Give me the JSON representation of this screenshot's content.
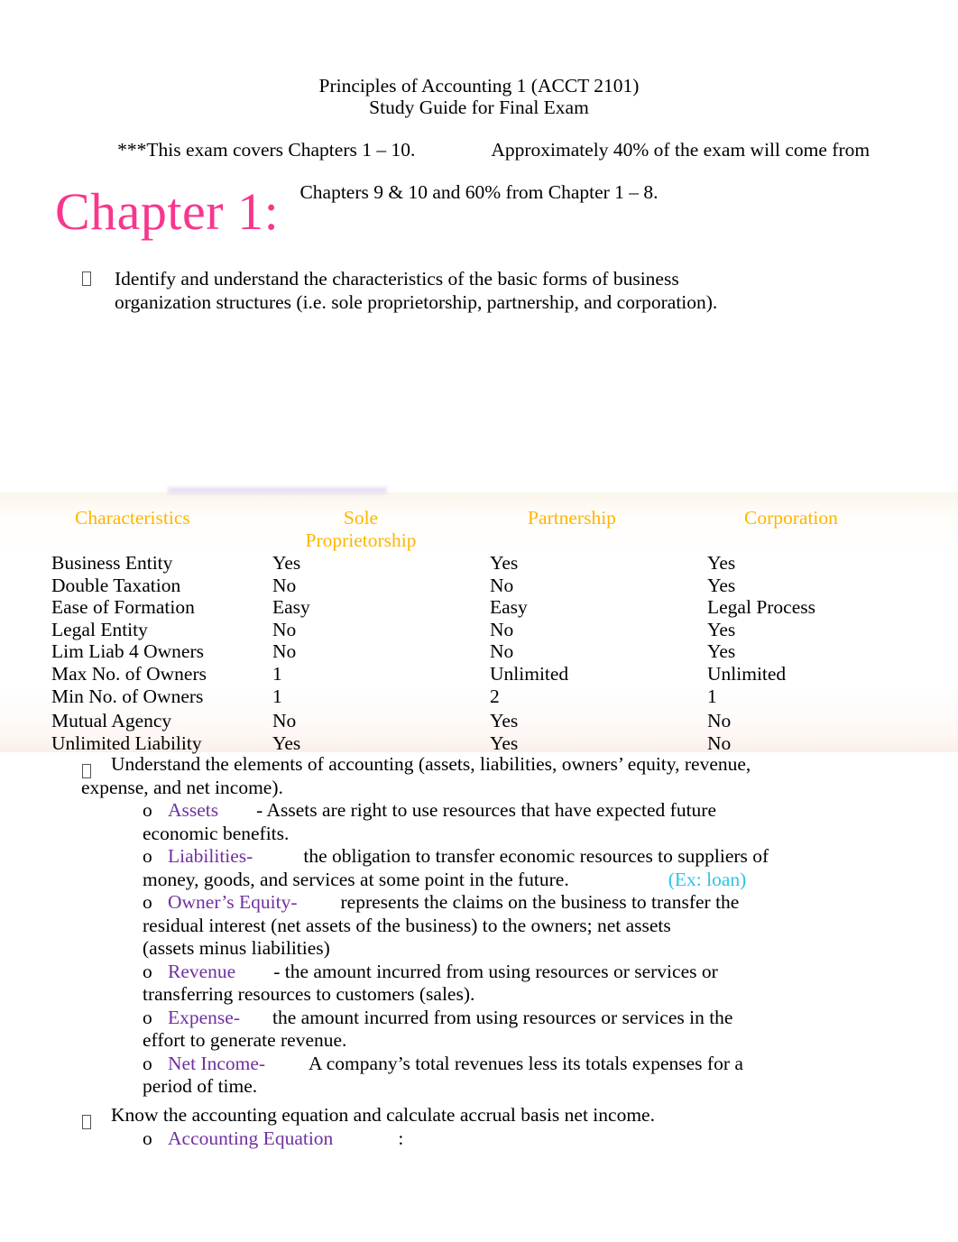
{
  "document": {
    "title_line_1": "Principles of Accounting 1 (ACCT 2101)",
    "title_line_2": "Study Guide for Final Exam",
    "note_line_1": "***This exam covers Chapters 1 – 10.",
    "note_line_1b": "Approximately 40% of the exam will come from",
    "note_line_2": "Chapters 9 & 10 and 60% from Chapter 1 – 8.",
    "chapter_heading": "Chapter 1:",
    "chapter_heading_color": "#F8368E"
  },
  "bullets": {
    "first": {
      "line_1": "Identify and understand the characteristics of the basic forms of business",
      "line_2": "organization structures (i.e. sole proprietorship, partnership, and corporation)."
    },
    "elements_intro": {
      "line_1": "Understand the elements of accounting (assets, liabilities, owners’ equity, revenue,",
      "line_2": "expense, and net income)."
    },
    "equation_intro": "Know the accounting equation and calculate accrual basis net income."
  },
  "table": {
    "header_color": "#FFB500",
    "columns": [
      "Characteristics",
      "Sole",
      "Proprietorship",
      "Partnership",
      "Corporation"
    ],
    "headers": {
      "characteristics": "Characteristics",
      "sole": "Sole",
      "proprietorship": "Proprietorship",
      "partnership": "Partnership",
      "corporation": "Corporation"
    },
    "rows": [
      {
        "label": "Business Entity",
        "sole": "Yes",
        "partnership": "Yes",
        "corporation": "Yes"
      },
      {
        "label": "Double Taxation",
        "sole": "No",
        "partnership": "No",
        "corporation": "Yes"
      },
      {
        "label": "Ease of Formation",
        "sole": "Easy",
        "partnership": "Easy",
        "corporation": "Legal Process"
      },
      {
        "label": "Legal Entity",
        "sole": "No",
        "partnership": "No",
        "corporation": "Yes"
      },
      {
        "label": "Lim Liab 4 Owners",
        "sole": "No",
        "partnership": "No",
        "corporation": "Yes"
      },
      {
        "label": "Max No. of Owners",
        "sole": "1",
        "partnership": "Unlimited",
        "corporation": "Unlimited"
      },
      {
        "label": "Min No. of Owners",
        "sole": "1",
        "partnership": "2",
        "corporation": "1"
      },
      {
        "label": "Mutual Agency",
        "sole": "No",
        "partnership": "Yes",
        "corporation": "No"
      },
      {
        "label": "Unlimited Liability",
        "sole": "Yes",
        "partnership": "Yes",
        "corporation": "No"
      }
    ]
  },
  "elements": {
    "term_color": "#7030A0",
    "example_color": "#29C5E8",
    "items": [
      {
        "term": "Assets",
        "def_line_1": "- Assets are right to use resources that have expected future",
        "def_line_2": "economic benefits.",
        "def_line_3": "",
        "example": ""
      },
      {
        "term": "Liabilities-",
        "def_line_1": "the obligation to transfer economic resources to suppliers of",
        "def_line_2": "money, goods, and services at some point in the future.",
        "def_line_3": "",
        "example": "(Ex: loan)"
      },
      {
        "term": "Owner’s Equity-",
        "def_line_1": "represents the claims on the business to transfer the",
        "def_line_2": "residual interest (net assets of the business) to the owners; net assets",
        "def_line_3": "(assets minus liabilities)",
        "example": ""
      },
      {
        "term": "Revenue",
        "def_line_1": "- the amount incurred from using resources or services or",
        "def_line_2": "transferring resources to customers (sales).",
        "def_line_3": "",
        "example": ""
      },
      {
        "term": "Expense-",
        "def_line_1": "the amount incurred from using resources or services in the",
        "def_line_2": "effort to generate revenue.",
        "def_line_3": "",
        "example": ""
      },
      {
        "term": "Net Income-",
        "def_line_1": "A company’s total revenues less its totals expenses for a",
        "def_line_2": "period of time.",
        "def_line_3": "",
        "example": ""
      }
    ]
  },
  "equation": {
    "term": "Accounting Equation",
    "colon": ":"
  }
}
